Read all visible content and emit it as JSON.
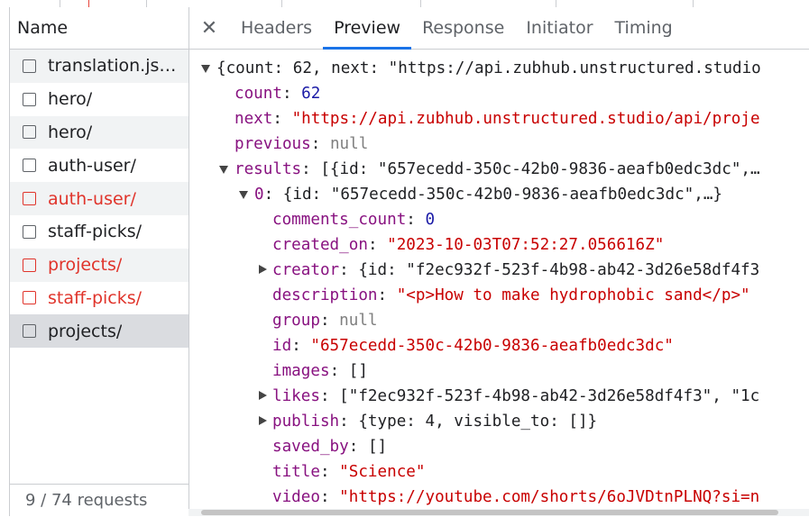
{
  "network": {
    "name_header": "Name",
    "requests": [
      {
        "label": "translation.js…",
        "error": false
      },
      {
        "label": "hero/",
        "error": false
      },
      {
        "label": "hero/",
        "error": false
      },
      {
        "label": "auth-user/",
        "error": false
      },
      {
        "label": "auth-user/",
        "error": true
      },
      {
        "label": "staff-picks/",
        "error": false
      },
      {
        "label": "projects/",
        "error": true
      },
      {
        "label": "staff-picks/",
        "error": true
      },
      {
        "label": "projects/",
        "error": false,
        "selected": true
      }
    ],
    "status": "9 / 74 requests"
  },
  "details": {
    "close_icon": "close-icon",
    "tabs": [
      "Headers",
      "Preview",
      "Response",
      "Initiator",
      "Timing"
    ],
    "active_tab": "Preview"
  },
  "preview": {
    "summary": "{count: 62, next: \"https://api.zubhub.unstructured.studio",
    "count_key": "count",
    "count_val": "62",
    "next_key": "next",
    "next_val": "\"https://api.zubhub.unstructured.studio/api/proje",
    "previous_key": "previous",
    "previous_val": "null",
    "results_key": "results",
    "results_summary": "[{id: \"657ecedd-350c-42b0-9836-aeafb0edc3dc\",…",
    "item_key": "0",
    "item_summary": "{id: \"657ecedd-350c-42b0-9836-aeafb0edc3dc\",…}",
    "comments_count_key": "comments_count",
    "comments_count_val": "0",
    "created_on_key": "created_on",
    "created_on_val": "\"2023-10-03T07:52:27.056616Z\"",
    "creator_key": "creator",
    "creator_val": "{id: \"f2ec932f-523f-4b98-ab42-3d26e58df4f3",
    "description_key": "description",
    "description_val": "\"<p>How to make hydrophobic sand</p>\"",
    "group_key": "group",
    "group_val": "null",
    "id_key": "id",
    "id_val": "\"657ecedd-350c-42b0-9836-aeafb0edc3dc\"",
    "images_key": "images",
    "images_val": "[]",
    "likes_key": "likes",
    "likes_val": "[\"f2ec932f-523f-4b98-ab42-3d26e58df4f3\", \"1c",
    "publish_key": "publish",
    "publish_val": "{type: 4, visible_to: []}",
    "saved_by_key": "saved_by",
    "saved_by_val": "[]",
    "title_key": "title",
    "title_val": "\"Science\"",
    "video_key": "video",
    "video_val": "\"https://youtube.com/shorts/6oJVDtnPLNQ?si=n"
  },
  "colors": {
    "key": "#881280",
    "number": "#1a1aa6",
    "string": "#c80000",
    "null": "#7f7f7f",
    "error_request": "#e0342b",
    "active_tab_underline": "#1a73e8"
  }
}
